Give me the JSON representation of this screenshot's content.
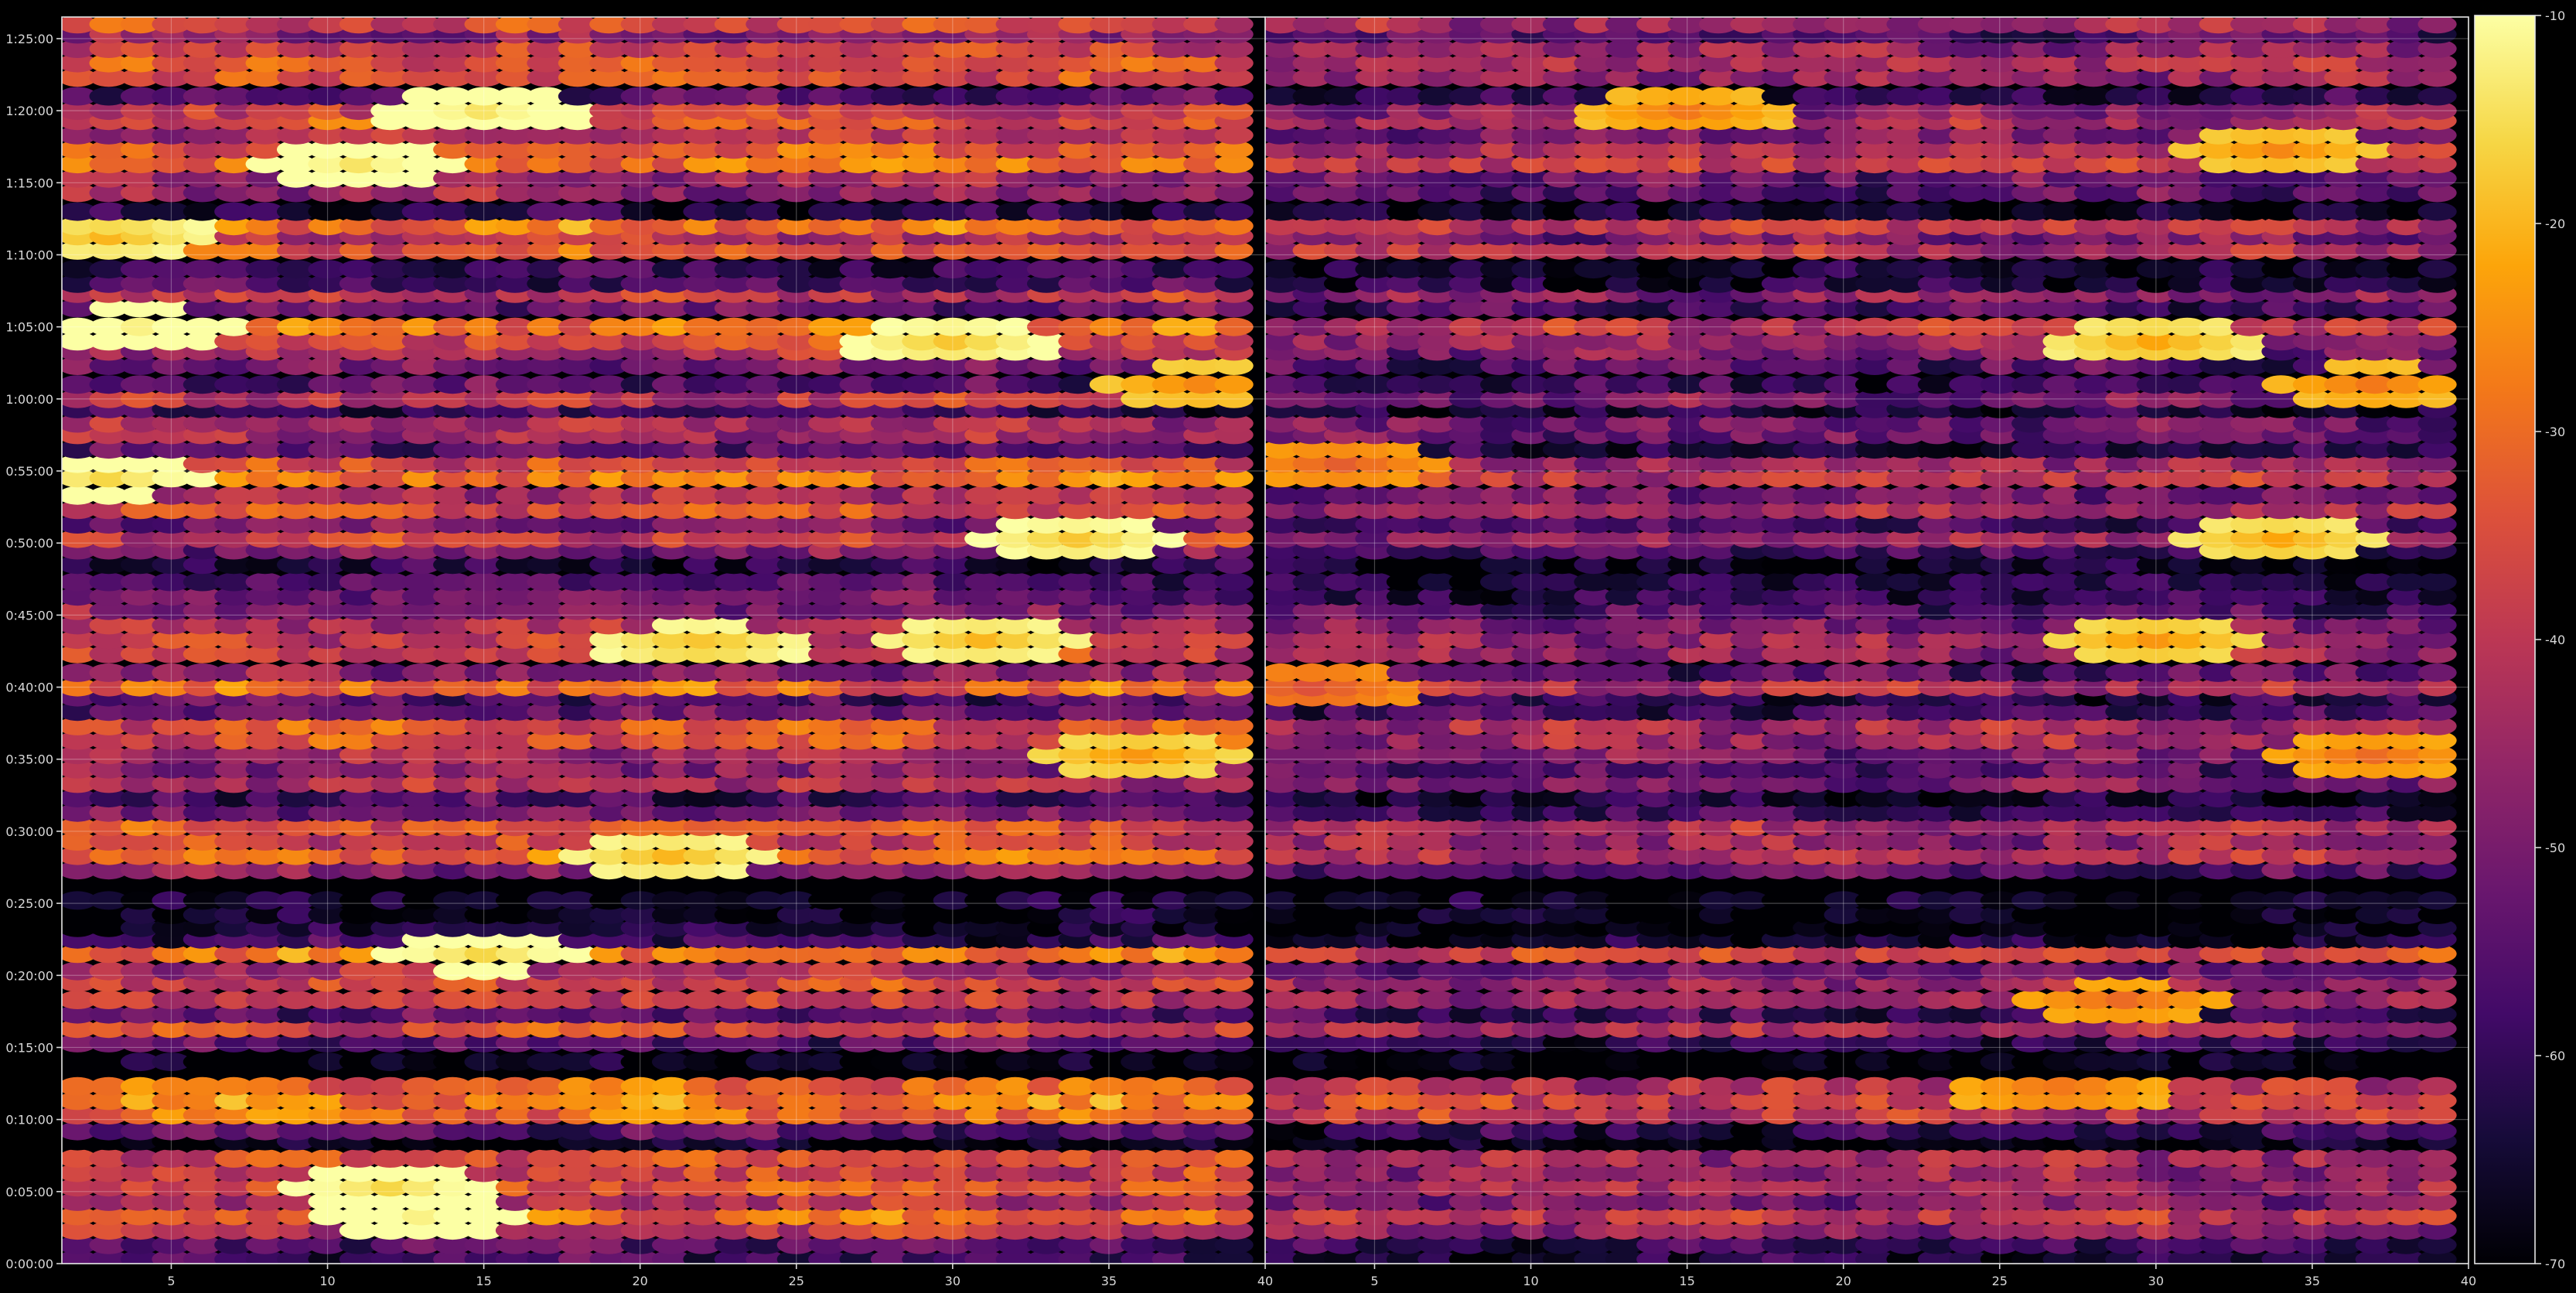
{
  "chart_data": {
    "type": "heatmap",
    "title": "",
    "xlabel": "",
    "ylabel": "",
    "colormap": "inferno",
    "background": "#000000",
    "grid": true,
    "panels": [
      {
        "name": "",
        "xlim": [
          1.5,
          40
        ],
        "xticks": [
          5,
          10,
          15,
          20,
          25,
          30,
          35,
          40
        ],
        "columns": [
          2,
          39
        ],
        "ylim_minutes": [
          0,
          86.5
        ],
        "yticks": [
          "0:00:00",
          "0:05:00",
          "0:10:00",
          "0:15:00",
          "0:20:00",
          "0:25:00",
          "0:30:00",
          "0:35:00",
          "0:40:00",
          "0:45:00",
          "0:50:00",
          "0:55:00",
          "1:00:00",
          "1:05:00",
          "1:10:00",
          "1:15:00",
          "1:20:00",
          "1:25:00"
        ],
        "rows": [
          {
            "t": 0.3,
            "v": -58
          },
          {
            "t": 1.3,
            "v": -55
          },
          {
            "t": 2.3,
            "v": -40
          },
          {
            "t": 3.3,
            "v": -30
          },
          {
            "t": 4.3,
            "v": -42
          },
          {
            "t": 5.3,
            "v": -34
          },
          {
            "t": 6.3,
            "v": -38
          },
          {
            "t": 7.3,
            "v": -36
          },
          {
            "t": 8.5,
            "v": -68
          },
          {
            "t": 9.2,
            "v": -55
          },
          {
            "t": 10.3,
            "v": -30
          },
          {
            "t": 11.3,
            "v": -27
          },
          {
            "t": 12.3,
            "v": -31
          },
          {
            "t": 14.0,
            "v": -68
          },
          {
            "t": 15.3,
            "v": -55
          },
          {
            "t": 16.3,
            "v": -36
          },
          {
            "t": 17.3,
            "v": -54
          },
          {
            "t": 18.3,
            "v": -38
          },
          {
            "t": 19.5,
            "v": -36
          },
          {
            "t": 20.3,
            "v": -44
          },
          {
            "t": 21.5,
            "v": -27
          },
          {
            "t": 22.5,
            "v": -60
          },
          {
            "t": 23.3,
            "v": -66
          },
          {
            "t": 24.2,
            "v": -68
          },
          {
            "t": 25.2,
            "v": -66
          },
          {
            "t": 27.3,
            "v": -48
          },
          {
            "t": 28.3,
            "v": -30
          },
          {
            "t": 29.3,
            "v": -37
          },
          {
            "t": 30.3,
            "v": -34
          },
          {
            "t": 31.3,
            "v": -52
          },
          {
            "t": 32.3,
            "v": -58
          },
          {
            "t": 33.3,
            "v": -42
          },
          {
            "t": 34.3,
            "v": -48
          },
          {
            "t": 35.3,
            "v": -43
          },
          {
            "t": 36.3,
            "v": -34
          },
          {
            "t": 37.3,
            "v": -34
          },
          {
            "t": 38.3,
            "v": -52
          },
          {
            "t": 39.3,
            "v": -56
          },
          {
            "t": 40.0,
            "v": -31
          },
          {
            "t": 41.0,
            "v": -48
          },
          {
            "t": 42.3,
            "v": -38
          },
          {
            "t": 43.3,
            "v": -38
          },
          {
            "t": 44.3,
            "v": -42
          },
          {
            "t": 45.3,
            "v": -48
          },
          {
            "t": 46.3,
            "v": -52
          },
          {
            "t": 47.3,
            "v": -56
          },
          {
            "t": 48.5,
            "v": -62
          },
          {
            "t": 49.5,
            "v": -50
          },
          {
            "t": 50.3,
            "v": -38
          },
          {
            "t": 51.3,
            "v": -50
          },
          {
            "t": 52.3,
            "v": -34
          },
          {
            "t": 53.3,
            "v": -42
          },
          {
            "t": 54.5,
            "v": -28
          },
          {
            "t": 55.5,
            "v": -35
          },
          {
            "t": 56.5,
            "v": -55
          },
          {
            "t": 57.5,
            "v": -44
          },
          {
            "t": 58.3,
            "v": -44
          },
          {
            "t": 59.3,
            "v": -60
          },
          {
            "t": 60.0,
            "v": -40
          },
          {
            "t": 61.0,
            "v": -55
          },
          {
            "t": 62.3,
            "v": -50
          },
          {
            "t": 63.3,
            "v": -42
          },
          {
            "t": 64.0,
            "v": -38
          },
          {
            "t": 65.0,
            "v": -28
          },
          {
            "t": 66.3,
            "v": -52
          },
          {
            "t": 67.3,
            "v": -40
          },
          {
            "t": 68.0,
            "v": -58
          },
          {
            "t": 69.0,
            "v": -60
          },
          {
            "t": 70.3,
            "v": -33
          },
          {
            "t": 71.3,
            "v": -42
          },
          {
            "t": 72.0,
            "v": -28
          },
          {
            "t": 73.0,
            "v": -62
          },
          {
            "t": 74.3,
            "v": -46
          },
          {
            "t": 75.3,
            "v": -44
          },
          {
            "t": 76.3,
            "v": -28
          },
          {
            "t": 77.3,
            "v": -32
          },
          {
            "t": 78.3,
            "v": -42
          },
          {
            "t": 79.3,
            "v": -34
          },
          {
            "t": 80.0,
            "v": -40
          },
          {
            "t": 81.0,
            "v": -56
          },
          {
            "t": 82.3,
            "v": -36
          },
          {
            "t": 83.3,
            "v": -34
          },
          {
            "t": 84.3,
            "v": -38
          },
          {
            "t": 85.3,
            "v": -48
          },
          {
            "t": 86.0,
            "v": -36
          }
        ],
        "hotspots": [
          {
            "x": 4,
            "t": 65.0,
            "v": -12
          },
          {
            "x": 3,
            "t": 54.5,
            "v": -16
          },
          {
            "x": 3,
            "t": 71.3,
            "v": -20
          },
          {
            "x": 13,
            "t": 3.3,
            "v": -12
          },
          {
            "x": 12,
            "t": 5.3,
            "v": -16
          },
          {
            "x": 15,
            "t": 21.5,
            "v": -16
          },
          {
            "x": 11,
            "t": 76.3,
            "v": -14
          },
          {
            "x": 15,
            "t": 80.0,
            "v": -14
          },
          {
            "x": 21,
            "t": 28.3,
            "v": -20
          },
          {
            "x": 34,
            "t": 50.3,
            "v": -18
          },
          {
            "x": 31,
            "t": 43.3,
            "v": -20
          },
          {
            "x": 36,
            "t": 35.3,
            "v": -24
          },
          {
            "x": 38,
            "t": 61.0,
            "v": -26
          },
          {
            "x": 22,
            "t": 43.0,
            "v": -20
          },
          {
            "x": 30,
            "t": 64.0,
            "v": -18
          }
        ]
      },
      {
        "name": "",
        "xlim": [
          1.5,
          40
        ],
        "xticks": [
          5,
          10,
          15,
          20,
          25,
          30,
          35,
          40
        ],
        "columns": [
          2,
          39
        ],
        "ylim_minutes": [
          0,
          86.5
        ],
        "yticks": [],
        "rows": [
          {
            "t": 0.3,
            "v": -64
          },
          {
            "t": 1.3,
            "v": -60
          },
          {
            "t": 2.3,
            "v": -48
          },
          {
            "t": 3.3,
            "v": -40
          },
          {
            "t": 4.3,
            "v": -50
          },
          {
            "t": 5.3,
            "v": -44
          },
          {
            "t": 6.3,
            "v": -46
          },
          {
            "t": 7.3,
            "v": -44
          },
          {
            "t": 8.5,
            "v": -70
          },
          {
            "t": 9.2,
            "v": -62
          },
          {
            "t": 10.3,
            "v": -40
          },
          {
            "t": 11.3,
            "v": -38
          },
          {
            "t": 12.3,
            "v": -42
          },
          {
            "t": 14.0,
            "v": -70
          },
          {
            "t": 15.3,
            "v": -60
          },
          {
            "t": 16.3,
            "v": -44
          },
          {
            "t": 17.3,
            "v": -60
          },
          {
            "t": 18.3,
            "v": -46
          },
          {
            "t": 19.5,
            "v": -44
          },
          {
            "t": 20.3,
            "v": -52
          },
          {
            "t": 21.5,
            "v": -36
          },
          {
            "t": 22.5,
            "v": -66
          },
          {
            "t": 23.3,
            "v": -70
          },
          {
            "t": 24.2,
            "v": -70
          },
          {
            "t": 25.2,
            "v": -68
          },
          {
            "t": 27.3,
            "v": -56
          },
          {
            "t": 28.3,
            "v": -42
          },
          {
            "t": 29.3,
            "v": -46
          },
          {
            "t": 30.3,
            "v": -44
          },
          {
            "t": 31.3,
            "v": -58
          },
          {
            "t": 32.3,
            "v": -64
          },
          {
            "t": 33.3,
            "v": -50
          },
          {
            "t": 34.3,
            "v": -56
          },
          {
            "t": 35.3,
            "v": -50
          },
          {
            "t": 36.3,
            "v": -44
          },
          {
            "t": 37.3,
            "v": -44
          },
          {
            "t": 38.3,
            "v": -58
          },
          {
            "t": 39.3,
            "v": -62
          },
          {
            "t": 40.0,
            "v": -42
          },
          {
            "t": 41.0,
            "v": -56
          },
          {
            "t": 42.3,
            "v": -46
          },
          {
            "t": 43.3,
            "v": -46
          },
          {
            "t": 44.3,
            "v": -50
          },
          {
            "t": 45.3,
            "v": -56
          },
          {
            "t": 46.3,
            "v": -60
          },
          {
            "t": 47.3,
            "v": -62
          },
          {
            "t": 48.5,
            "v": -66
          },
          {
            "t": 49.5,
            "v": -58
          },
          {
            "t": 50.3,
            "v": -46
          },
          {
            "t": 51.3,
            "v": -58
          },
          {
            "t": 52.3,
            "v": -44
          },
          {
            "t": 53.3,
            "v": -50
          },
          {
            "t": 54.5,
            "v": -40
          },
          {
            "t": 55.5,
            "v": -44
          },
          {
            "t": 56.5,
            "v": -62
          },
          {
            "t": 57.5,
            "v": -52
          },
          {
            "t": 58.3,
            "v": -52
          },
          {
            "t": 59.3,
            "v": -64
          },
          {
            "t": 60.0,
            "v": -50
          },
          {
            "t": 61.0,
            "v": -60
          },
          {
            "t": 62.3,
            "v": -56
          },
          {
            "t": 63.3,
            "v": -50
          },
          {
            "t": 64.0,
            "v": -46
          },
          {
            "t": 65.0,
            "v": -40
          },
          {
            "t": 66.3,
            "v": -58
          },
          {
            "t": 67.3,
            "v": -48
          },
          {
            "t": 68.0,
            "v": -64
          },
          {
            "t": 69.0,
            "v": -66
          },
          {
            "t": 70.3,
            "v": -42
          },
          {
            "t": 71.3,
            "v": -50
          },
          {
            "t": 72.0,
            "v": -40
          },
          {
            "t": 73.0,
            "v": -66
          },
          {
            "t": 74.3,
            "v": -54
          },
          {
            "t": 75.3,
            "v": -52
          },
          {
            "t": 76.3,
            "v": -38
          },
          {
            "t": 77.3,
            "v": -42
          },
          {
            "t": 78.3,
            "v": -50
          },
          {
            "t": 79.3,
            "v": -44
          },
          {
            "t": 80.0,
            "v": -48
          },
          {
            "t": 81.0,
            "v": -62
          },
          {
            "t": 82.3,
            "v": -46
          },
          {
            "t": 83.3,
            "v": -42
          },
          {
            "t": 84.3,
            "v": -46
          },
          {
            "t": 85.3,
            "v": -56
          },
          {
            "t": 86.0,
            "v": -44
          }
        ],
        "hotspots": [
          {
            "x": 34,
            "t": 50.3,
            "v": -22
          },
          {
            "x": 30,
            "t": 43.3,
            "v": -24
          },
          {
            "x": 30,
            "t": 64.0,
            "v": -22
          },
          {
            "x": 37,
            "t": 61.0,
            "v": -28
          },
          {
            "x": 34,
            "t": 77.3,
            "v": -26
          },
          {
            "x": 4,
            "t": 55.5,
            "v": -32
          },
          {
            "x": 3,
            "t": 40.0,
            "v": -34
          },
          {
            "x": 15,
            "t": 80.0,
            "v": -28
          },
          {
            "x": 27,
            "t": 12.0,
            "v": -30
          },
          {
            "x": 29,
            "t": 18.3,
            "v": -30
          },
          {
            "x": 37,
            "t": 35.3,
            "v": -30
          }
        ]
      }
    ],
    "colorbar": {
      "vmin": -70,
      "vmax": -10,
      "ticks": [
        "-10",
        "-20",
        "-30",
        "-40",
        "-50",
        "-60",
        "-70"
      ]
    }
  }
}
